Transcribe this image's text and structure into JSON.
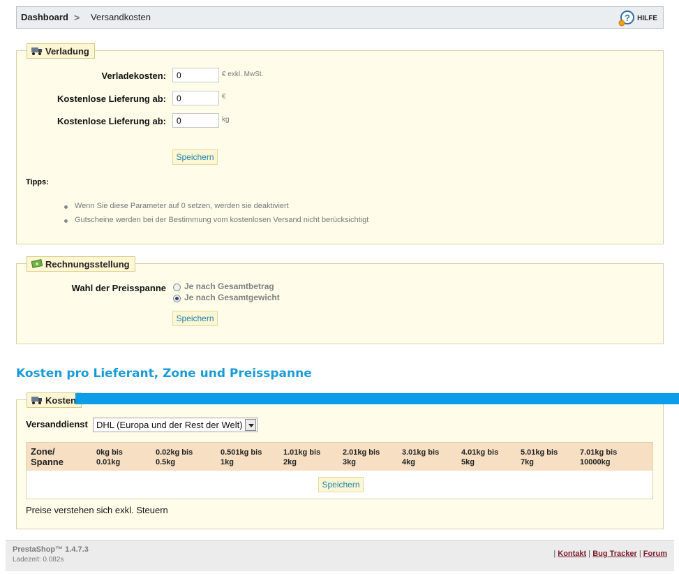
{
  "breadcrumb": {
    "root": "Dashboard",
    "separator": ">",
    "current": "Versandkosten"
  },
  "help": {
    "label": "HILFE",
    "icon": "help-icon"
  },
  "verladung": {
    "legend": "Verladung",
    "icon": "truck-icon",
    "fields": [
      {
        "label": "Verladekosten:",
        "value": "0",
        "unit": "€ exkl. MwSt."
      },
      {
        "label": "Kostenlose Lieferung ab:",
        "value": "0",
        "unit": "€"
      },
      {
        "label": "Kostenlose Lieferung ab:",
        "value": "0",
        "unit": "kg"
      }
    ],
    "save_label": "Speichern",
    "tips_title": "Tipps:",
    "tips": [
      "Wenn Sie diese Parameter auf 0 setzen, werden sie deaktiviert",
      "Gutscheine werden bei der Bestimmung vom kostenlosen Versand nicht berücksichtigt"
    ]
  },
  "rechnung": {
    "legend": "Rechnungsstellung",
    "icon": "money-icon",
    "label": "Wahl der Preisspanne",
    "options": [
      {
        "label": "Je nach Gesamtbetrag",
        "checked": false
      },
      {
        "label": "Je nach Gesamtgewicht",
        "checked": true
      }
    ],
    "save_label": "Speichern"
  },
  "kosten": {
    "section_title": "Kosten pro Lieferant, Zone und Preisspanne",
    "legend": "Kosten",
    "icon": "truck-icon",
    "carrier_label": "Versanddienst",
    "carrier_value": "DHL (Europa und der Rest der Welt)",
    "table_headers": [
      "Zone/ Spanne",
      "0kg bis 0.01kg",
      "0.02kg bis 0.5kg",
      "0.501kg bis 1kg",
      "1.01kg bis 2kg",
      "2.01kg bis 3kg",
      "3.01kg bis 4kg",
      "4.01kg bis 5kg",
      "5.01kg bis 7kg",
      "7.01kg bis 10000kg"
    ],
    "save_label": "Speichern",
    "note": "Preise verstehen sich exkl. Steuern"
  },
  "footer": {
    "product": "PrestaShop™ 1.4.7.3",
    "load_time": "Ladezeit: 0.082s",
    "links": [
      "Kontakt",
      "Bug Tracker",
      "Forum"
    ],
    "link_separator": "|"
  },
  "colors": {
    "accent_blue": "#1a9bd7",
    "panel_bg": "#fffde9",
    "table_header_bg": "#f6dfc2",
    "link_color": "#7a1d2c"
  }
}
